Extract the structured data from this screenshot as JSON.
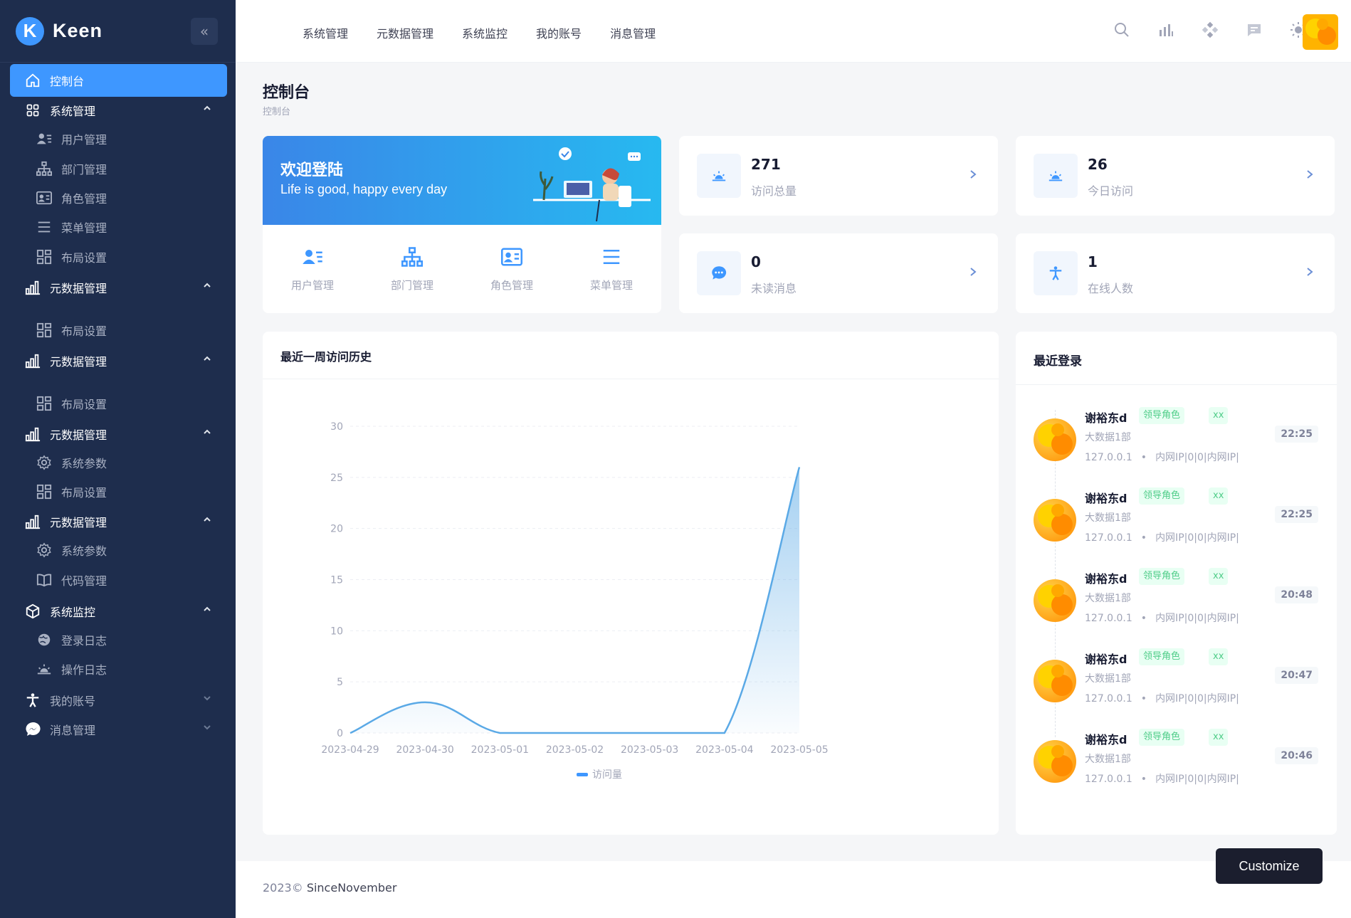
{
  "brand": {
    "name": "Keen",
    "logo_letter": "K"
  },
  "sidebar": {
    "items": [
      {
        "label": "控制台",
        "icon": "home-icon",
        "active": true
      },
      {
        "label": "系统管理",
        "icon": "grid-icon",
        "chevron": "up"
      },
      {
        "label": "用户管理",
        "icon": "user-list-icon",
        "sub": true
      },
      {
        "label": "部门管理",
        "icon": "sitemap-icon",
        "sub": true
      },
      {
        "label": "角色管理",
        "icon": "id-card-icon",
        "sub": true
      },
      {
        "label": "菜单管理",
        "icon": "menu-lines-icon",
        "sub": true
      },
      {
        "label": "布局设置",
        "icon": "layout-icon",
        "sub": true
      },
      {
        "label": "元数据管理",
        "icon": "bar-chart-icon",
        "chevron": "up"
      },
      {
        "label": "布局设置",
        "icon": "layout-icon",
        "sub": true
      },
      {
        "label": "元数据管理",
        "icon": "bar-chart-icon",
        "chevron": "up"
      },
      {
        "label": "布局设置",
        "icon": "layout-icon",
        "sub": true
      },
      {
        "label": "元数据管理",
        "icon": "bar-chart-icon",
        "chevron": "up"
      },
      {
        "label": "系统参数",
        "icon": "gear-icon",
        "sub": true
      },
      {
        "label": "布局设置",
        "icon": "layout-icon",
        "sub": true
      },
      {
        "label": "元数据管理",
        "icon": "bar-chart-icon",
        "chevron": "up"
      },
      {
        "label": "系统参数",
        "icon": "gear-icon",
        "sub": true
      },
      {
        "label": "代码管理",
        "icon": "book-icon",
        "sub": true
      },
      {
        "label": "系统监控",
        "icon": "cube-icon",
        "chevron": "up"
      },
      {
        "label": "登录日志",
        "icon": "globe-icon",
        "sub": true
      },
      {
        "label": "操作日志",
        "icon": "sunrise-icon",
        "sub": true
      },
      {
        "label": "我的账号",
        "icon": "person-icon",
        "chevron": "down"
      },
      {
        "label": "消息管理",
        "icon": "messenger-icon",
        "chevron": "down"
      }
    ]
  },
  "header": {
    "nav": [
      "系统管理",
      "元数据管理",
      "系统监控",
      "我的账号",
      "消息管理"
    ],
    "icons": [
      "search-icon",
      "bar-stats-icon",
      "apps-icon",
      "chat-icon",
      "sun-icon"
    ]
  },
  "page": {
    "title": "控制台",
    "breadcrumb": "控制台"
  },
  "welcome": {
    "title": "欢迎登陆",
    "subtitle": "Life is good, happy every day",
    "quick_links": [
      {
        "label": "用户管理",
        "icon": "user-list-icon"
      },
      {
        "label": "部门管理",
        "icon": "sitemap-icon"
      },
      {
        "label": "角色管理",
        "icon": "id-card-icon"
      },
      {
        "label": "菜单管理",
        "icon": "menu-lines-icon"
      }
    ]
  },
  "stats": [
    {
      "value": "271",
      "label": "访问总量",
      "icon": "sunrise-icon"
    },
    {
      "value": "26",
      "label": "今日访问",
      "icon": "sunrise-icon"
    },
    {
      "value": "0",
      "label": "未读消息",
      "icon": "chat-bubble-icon"
    },
    {
      "value": "1",
      "label": "在线人数",
      "icon": "person-icon"
    }
  ],
  "chart_title": "最近一周访问历史",
  "chart_data": {
    "type": "area",
    "x": [
      "2023-04-29",
      "2023-04-30",
      "2023-05-01",
      "2023-05-02",
      "2023-05-03",
      "2023-05-04",
      "2023-05-05"
    ],
    "series": [
      {
        "name": "访问量",
        "values": [
          0,
          3,
          0,
          0,
          0,
          0,
          26
        ]
      }
    ],
    "ylim": [
      0,
      30
    ],
    "yticks": [
      0,
      5,
      10,
      15,
      20,
      25,
      30
    ],
    "grid": true,
    "legend": "bottom-center",
    "color": "#5aa9e6"
  },
  "recent_login": {
    "title": "最近登录",
    "items": [
      {
        "name": "谢裕东d",
        "tags": [
          "领导角色",
          "xx"
        ],
        "dept": "大数据1部",
        "ip": "127.0.0.1",
        "location": "内网IP|0|0|内网IP|",
        "time": "22:25"
      },
      {
        "name": "谢裕东d",
        "tags": [
          "领导角色",
          "xx"
        ],
        "dept": "大数据1部",
        "ip": "127.0.0.1",
        "location": "内网IP|0|0|内网IP|",
        "time": "22:25"
      },
      {
        "name": "谢裕东d",
        "tags": [
          "领导角色",
          "xx"
        ],
        "dept": "大数据1部",
        "ip": "127.0.0.1",
        "location": "内网IP|0|0|内网IP|",
        "time": "20:48"
      },
      {
        "name": "谢裕东d",
        "tags": [
          "领导角色",
          "xx"
        ],
        "dept": "大数据1部",
        "ip": "127.0.0.1",
        "location": "内网IP|0|0|内网IP|",
        "time": "20:47"
      },
      {
        "name": "谢裕东d",
        "tags": [
          "领导角色",
          "xx"
        ],
        "dept": "大数据1部",
        "ip": "127.0.0.1",
        "location": "内网IP|0|0|内网IP|",
        "time": "20:46"
      }
    ]
  },
  "footer": {
    "year": "2023©",
    "brand": "SinceNovember"
  },
  "customize_label": "Customize",
  "colors": {
    "sidebar_bg": "#1e2d4d",
    "accent": "#3e97ff",
    "tag_green": "#50cd89"
  }
}
